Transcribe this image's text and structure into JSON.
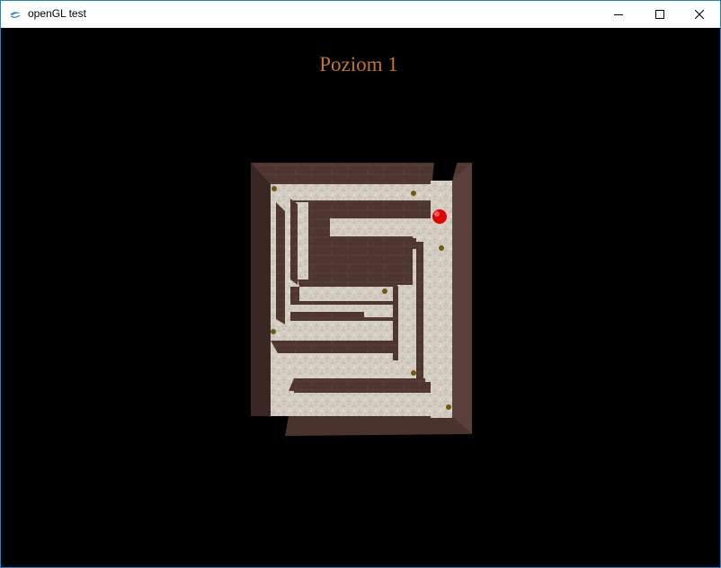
{
  "window": {
    "title": "openGL test",
    "icon": "java-cup-icon",
    "controls": [
      "minimize-icon",
      "maximize-icon",
      "close-icon"
    ],
    "border_color": "#1883d7"
  },
  "game": {
    "level_label": "Poziom 1",
    "background_color": "#000000",
    "title_color": "#c1772f",
    "wall_color": "#4e3530",
    "floor_color": "#d6d0c4",
    "player_color": "#e30000",
    "coin_color": "#6e5a10"
  }
}
